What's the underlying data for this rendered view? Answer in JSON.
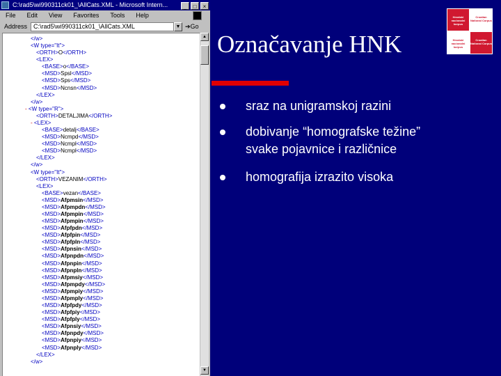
{
  "browser": {
    "title": "C:\\rad5\\wi990311ck01_\\AllCats.XML - Microsoft Intern...",
    "menu": [
      "File",
      "Edit",
      "View",
      "Favorites",
      "Tools",
      "Help"
    ],
    "address_label": "Address",
    "address_value": "C:\\rad5\\wi990311ck01_\\AllCats.XML",
    "go_label": "Go",
    "xml_lines": [
      {
        "indent": 40,
        "text": "</w>"
      },
      {
        "indent": 40,
        "text": "<W type=\"It\">"
      },
      {
        "indent": 48,
        "text": "<ORTH>O</ORTH>"
      },
      {
        "indent": 48,
        "text": "<LEX>"
      },
      {
        "indent": 56,
        "text": "<BASE>o</BASE>"
      },
      {
        "indent": 56,
        "text": "<MSD>Spsl</MSD>"
      },
      {
        "indent": 56,
        "text": "<MSD>Sps</MSD>"
      },
      {
        "indent": 56,
        "text": "<MSD>Ncnsn</MSD>"
      },
      {
        "indent": 48,
        "text": "</LEX>"
      },
      {
        "indent": 40,
        "text": "</w>"
      },
      {
        "indent": 32,
        "text": "- <W type=\"R\">"
      },
      {
        "indent": 48,
        "text": "<ORTH>DETALJIMA</ORTH>"
      },
      {
        "indent": 40,
        "text": "- <LEX>"
      },
      {
        "indent": 56,
        "text": "<BASE>detalj</BASE>"
      },
      {
        "indent": 56,
        "text": "<MSD>Ncmpd</MSD>"
      },
      {
        "indent": 56,
        "text": "<MSD>Ncmpl</MSD>"
      },
      {
        "indent": 56,
        "text": "<MSD>Ncmpl</MSD>"
      },
      {
        "indent": 48,
        "text": "</LEX>"
      },
      {
        "indent": 40,
        "text": "</w>"
      },
      {
        "indent": 40,
        "text": "<W type=\"It\">"
      },
      {
        "indent": 48,
        "text": "<ORTH>VEZANIM</ORTH>"
      },
      {
        "indent": 48,
        "text": "<LEX>"
      },
      {
        "indent": 56,
        "text": "<BASE>vezan</BASE>"
      },
      {
        "indent": 56,
        "text": "<MSD>Afpmsin</MSD>",
        "bold": "Afpmsin"
      },
      {
        "indent": 56,
        "text": "<MSD>Afpmpdn</MSD>",
        "bold": "Afpmpdn"
      },
      {
        "indent": 56,
        "text": "<MSD>Afpmpin</MSD>",
        "bold": "Afpmpin"
      },
      {
        "indent": 56,
        "text": "<MSD>Afpmpin</MSD>",
        "bold": "Afpmpin"
      },
      {
        "indent": 56,
        "text": "<MSD>Afpfpdn</MSD>",
        "bold": "Afpfpdn"
      },
      {
        "indent": 56,
        "text": "<MSD>Afpfpin</MSD>",
        "bold": "Afpfpin"
      },
      {
        "indent": 56,
        "text": "<MSD>Afpfpln</MSD>",
        "bold": "Afpfpln"
      },
      {
        "indent": 56,
        "text": "<MSD>Afpnsin</MSD>",
        "bold": "Afpnsin"
      },
      {
        "indent": 56,
        "text": "<MSD>Afpnpdn</MSD>",
        "bold": "Afpnpdn"
      },
      {
        "indent": 56,
        "text": "<MSD>Afpnpin</MSD>",
        "bold": "Afpnpin"
      },
      {
        "indent": 56,
        "text": "<MSD>Afpnpln</MSD>",
        "bold": "Afpnpln"
      },
      {
        "indent": 56,
        "text": "<MSD>Afpmsiy</MSD>",
        "bold": "Afpmsiy"
      },
      {
        "indent": 56,
        "text": "<MSD>Afpmpdy</MSD>",
        "bold": "Afpmpdy"
      },
      {
        "indent": 56,
        "text": "<MSD>Afpmpiy</MSD>",
        "bold": "Afpmpiy"
      },
      {
        "indent": 56,
        "text": "<MSD>Afpmply</MSD>",
        "bold": "Afpmply"
      },
      {
        "indent": 56,
        "text": "<MSD>Afpfpdy</MSD>",
        "bold": "Afpfpdy"
      },
      {
        "indent": 56,
        "text": "<MSD>Afpfpiy</MSD>",
        "bold": "Afpfpiy"
      },
      {
        "indent": 56,
        "text": "<MSD>Afpfply</MSD>",
        "bold": "Afpfply"
      },
      {
        "indent": 56,
        "text": "<MSD>Afpnsiy</MSD>",
        "bold": "Afpnsiy"
      },
      {
        "indent": 56,
        "text": "<MSD>Afpnpdy</MSD>",
        "bold": "Afpnpdy"
      },
      {
        "indent": 56,
        "text": "<MSD>Afpnpiy</MSD>",
        "bold": "Afpnpiy"
      },
      {
        "indent": 56,
        "text": "<MSD>Afpnply</MSD>",
        "bold": "Afpnply"
      },
      {
        "indent": 48,
        "text": "</LEX>"
      },
      {
        "indent": 40,
        "text": "</w>"
      }
    ]
  },
  "slide": {
    "title": "Označavanje HNK",
    "bullets": [
      "sraz na unigramskoj razini",
      "dobivanje “homografske težine”\nsvake pojavnice i različnice",
      "homografija izrazito visoka"
    ]
  },
  "logo": {
    "q1": "Hrvatski nacionalni korpus",
    "q2": "Croatian National Corpus",
    "q3": "Hrvatski nacionalni korpus",
    "q4": "Croatian National Corpus"
  },
  "colors": {
    "background": "#00007a",
    "accent_bar": "#e00000",
    "logo_red": "#d01830"
  }
}
